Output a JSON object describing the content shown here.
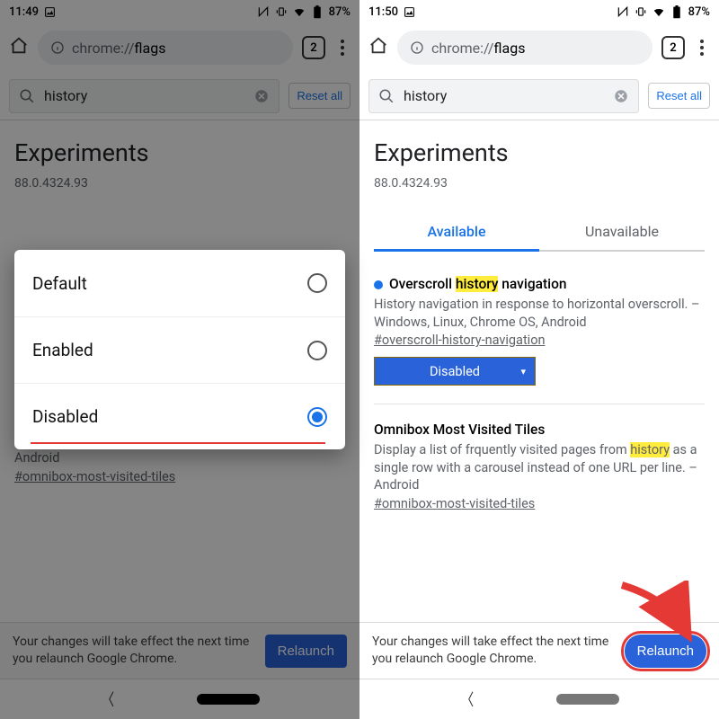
{
  "status": {
    "time_left": "11:49",
    "time_right": "11:50",
    "battery": "87%"
  },
  "browser": {
    "url_dim": "chrome://",
    "url_strong": "flags",
    "tab_count": "2"
  },
  "search": {
    "term": "history",
    "reset": "Reset all"
  },
  "page": {
    "heading": "Experiments",
    "version": "88.0.4324.93",
    "tab_available": "Available",
    "tab_unavailable": "Unavailable"
  },
  "flag1": {
    "title_pre": "Overscroll ",
    "title_hl": "history",
    "title_post": " navigation",
    "desc": "History navigation in response to horizontal overscroll. – Windows, Linux, Chrome OS, Android",
    "hash": "#overscroll-history-navigation",
    "select": "Disabled"
  },
  "flag2": {
    "title": "Omnibox Most Visited Tiles",
    "desc_pre": "Display a list of frquently visited pages from ",
    "desc_hl": "history",
    "desc_post": " as a single row with a carousel instead of one URL per line. – Android",
    "hash": "#omnibox-most-visited-tiles"
  },
  "relaunch": {
    "msg": "Your changes will take effect the next time you relaunch Google Chrome.",
    "btn": "Relaunch"
  },
  "dialog": {
    "opt1": "Default",
    "opt2": "Enabled",
    "opt3": "Disabled"
  }
}
